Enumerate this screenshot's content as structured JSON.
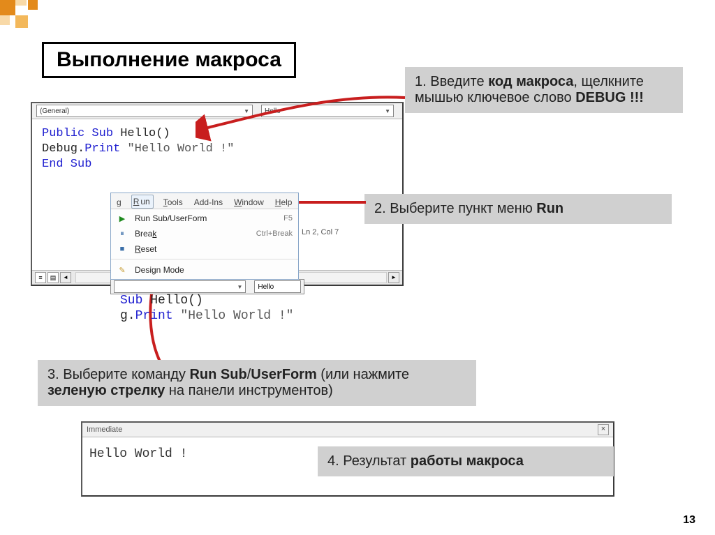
{
  "title": "Выполнение макроса",
  "code_pane": {
    "dropdown_general": "(General)",
    "dropdown_proc": "Hello",
    "lines": {
      "l1a": "Public Sub ",
      "l1b": "Hello()",
      "l2a": "  Debug.",
      "l2b": "Print ",
      "l2c": "\"Hello World !\"",
      "l3a": "End Sub"
    }
  },
  "code_below": {
    "l1": "Sub Hello()",
    "l2a": "g.",
    "l2b": "Print ",
    "l2c": "\"Hello World !\""
  },
  "menubar": {
    "item_g": "g",
    "item_run": "Run",
    "item_tools": "Tools",
    "item_addins": "Add-Ins",
    "item_window": "Window",
    "item_help": "Help"
  },
  "menu": {
    "run_label": "Run Sub/UserForm",
    "run_sc": "F5",
    "break_label": "Break",
    "break_sc": "Ctrl+Break",
    "reset_label": "Reset",
    "design_label": "Design Mode"
  },
  "status_ln": "Ln 2, Col 7",
  "callouts": {
    "c1": {
      "pre": "1. Введите ",
      "b1": "код макроса",
      "mid": ", щелкните мышью ключевое слово ",
      "b2": "DEBUG !!!"
    },
    "c2": {
      "pre": "2. Выберите пункт меню ",
      "b1": "Run"
    },
    "c3": {
      "pre": "3. Выберите команду ",
      "b1": "Run Sub",
      "mid": "/",
      "b2": "UserForm",
      "mid2": " (или нажмите ",
      "b3": "зеленую стрелку",
      "tail": " на панели инструментов)"
    },
    "c4": {
      "pre": "4. Результат ",
      "b1": "работы макроса"
    }
  },
  "immediate": {
    "title": "Immediate",
    "output": "Hello World !"
  },
  "page_num": "13"
}
